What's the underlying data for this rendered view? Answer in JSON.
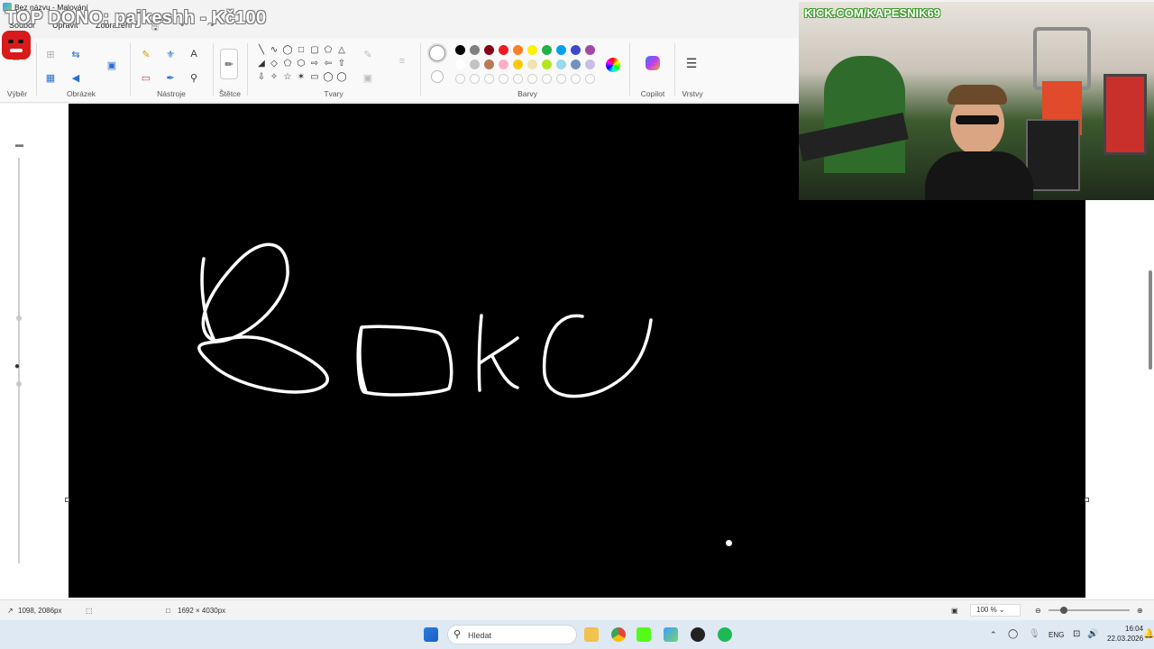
{
  "window": {
    "title": "Bez názvu - Malování"
  },
  "menu": {
    "file": "Soubor",
    "edit": "Upravit",
    "view": "Zobrazení"
  },
  "ribbon": {
    "groups": {
      "selection": "Výběr",
      "image": "Obrázek",
      "tools": "Nástroje",
      "brushes": "Štětce",
      "shapes": "Tvary",
      "colors": "Barvy",
      "copilot": "Copilot",
      "layers": "Vrstvy"
    },
    "palette_row1": [
      "#000000",
      "#7f7f7f",
      "#880015",
      "#ed1c24",
      "#ff7f27",
      "#fff200",
      "#22b14c",
      "#00a2e8",
      "#3f48cc",
      "#a349a4"
    ],
    "palette_row2": [
      "#ffffff",
      "#c3c3c3",
      "#b97a57",
      "#ffaec9",
      "#ffc90e",
      "#efe4b0",
      "#b5e61d",
      "#99d9ea",
      "#7092be",
      "#c8bfe7"
    ]
  },
  "canvas": {
    "drawn_text": "Bohc",
    "background": "#000000",
    "ink": "#ffffff"
  },
  "status": {
    "cursor_pos": "1098, 2086px",
    "canvas_size": "1692 × 4030px",
    "zoom": "100 %"
  },
  "taskbar": {
    "search_placeholder": "Hledat",
    "language": "ENG",
    "time": "16:04",
    "date": "22.03.2026"
  },
  "stream_overlay": {
    "donation": "TOP DONO: pajkeshh - Kč100",
    "channel": "KICK.COM/KAPESNIK69"
  }
}
